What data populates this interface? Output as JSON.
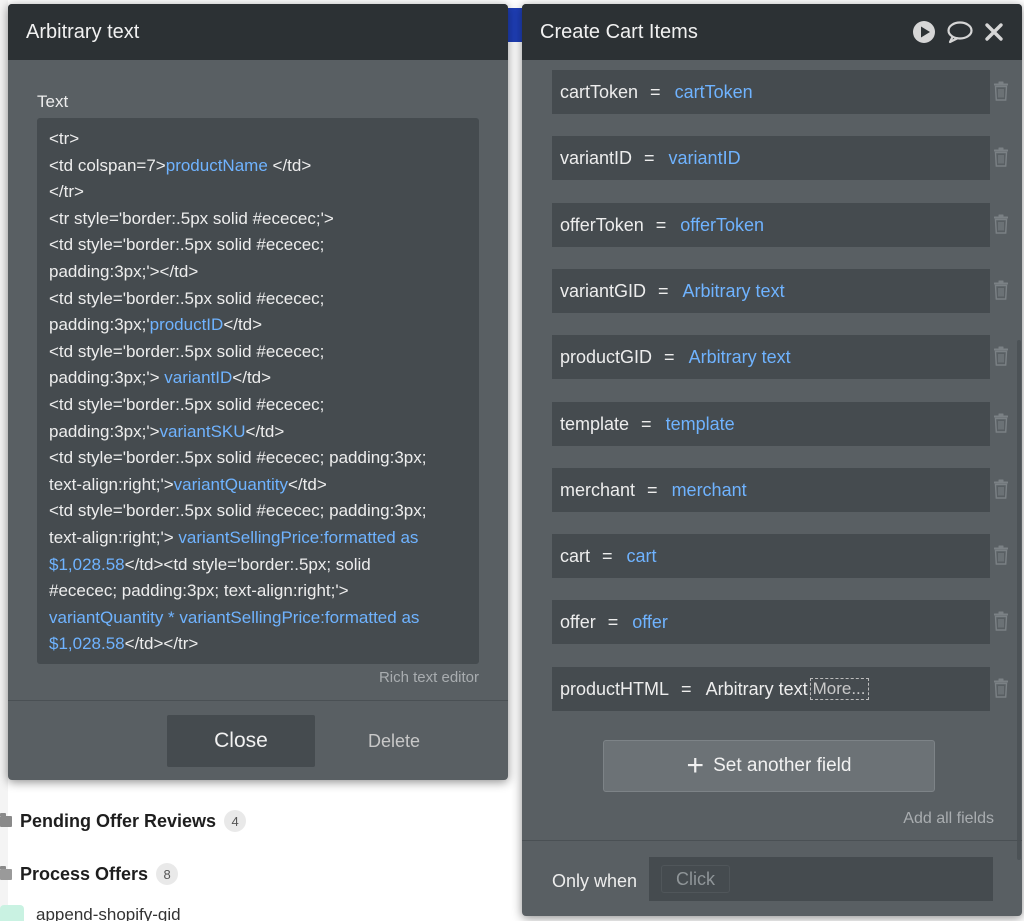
{
  "background": {
    "workflow_items": [
      {
        "label": "Pending Offer Reviews",
        "count": "4"
      },
      {
        "label": "Process Offers",
        "count": "8"
      }
    ],
    "sub_item": "append-shopify-gid"
  },
  "arbitrary_text_panel": {
    "title": "Arbitrary text",
    "field_label": "Text",
    "code_lines": [
      [
        {
          "t": "<tr>"
        }
      ],
      [
        {
          "t": "<td colspan=7>"
        },
        {
          "t": "productName",
          "dyn": true
        },
        {
          "t": " </td>"
        }
      ],
      [
        {
          "t": "</tr>"
        }
      ],
      [
        {
          "t": "<tr style='border:.5px solid #ececec;'>"
        }
      ],
      [
        {
          "t": "<td style='border:.5px solid #ececec;"
        }
      ],
      [
        {
          "t": "padding:3px;'></td>"
        }
      ],
      [
        {
          "t": "<td style='border:.5px solid #ececec;"
        }
      ],
      [
        {
          "t": "padding:3px;'"
        },
        {
          "t": "productID",
          "dyn": true
        },
        {
          "t": "</td>"
        }
      ],
      [
        {
          "t": "<td style='border:.5px solid #ececec;"
        }
      ],
      [
        {
          "t": "padding:3px;'> "
        },
        {
          "t": "variantID",
          "dyn": true
        },
        {
          "t": "</td>"
        }
      ],
      [
        {
          "t": "<td style='border:.5px solid #ececec;"
        }
      ],
      [
        {
          "t": "padding:3px;'>"
        },
        {
          "t": "variantSKU",
          "dyn": true
        },
        {
          "t": "</td>"
        }
      ],
      [
        {
          "t": "<td style='border:.5px solid #ececec; padding:3px;"
        }
      ],
      [
        {
          "t": "text-align:right;'>"
        },
        {
          "t": "variantQuantity",
          "dyn": true
        },
        {
          "t": "</td>"
        }
      ],
      [
        {
          "t": "<td style='border:.5px solid #ececec; padding:3px;"
        }
      ],
      [
        {
          "t": "text-align:right;'> "
        },
        {
          "t": "variantSellingPrice:formatted as",
          "dyn": true
        }
      ],
      [
        {
          "t": "$1,028.58",
          "dyn": true
        },
        {
          "t": "</td><td style='border:.5px; solid"
        }
      ],
      [
        {
          "t": "#ececec; padding:3px; text-align:right;'>"
        }
      ],
      [
        {
          "t": "variantQuantity * variantSellingPrice:formatted as",
          "dyn": true
        }
      ],
      [
        {
          "t": "$1,028.58",
          "dyn": true
        },
        {
          "t": "</td></tr>"
        }
      ]
    ],
    "rich_text_editor_label": "Rich text editor",
    "close_label": "Close",
    "delete_label": "Delete"
  },
  "cart_panel": {
    "title": "Create Cart Items",
    "icons": [
      "play-icon",
      "comment-icon",
      "close-icon"
    ],
    "fields": [
      {
        "key": "cartToken",
        "eq": "=",
        "value": "cartToken",
        "dynamic": true
      },
      {
        "key": "variantID",
        "eq": "=",
        "value": "variantID",
        "dynamic": true
      },
      {
        "key": "offerToken",
        "eq": "=",
        "value": "offerToken",
        "dynamic": true
      },
      {
        "key": "variantGID",
        "eq": "=",
        "value": "Arbitrary text",
        "dynamic": true
      },
      {
        "key": "productGID",
        "eq": "=",
        "value": "Arbitrary text",
        "dynamic": true
      },
      {
        "key": "template",
        "eq": "=",
        "value": "template",
        "dynamic": true
      },
      {
        "key": "merchant",
        "eq": "=",
        "value": "merchant",
        "dynamic": true
      },
      {
        "key": "cart",
        "eq": "=",
        "value": "cart",
        "dynamic": true
      },
      {
        "key": "offer",
        "eq": "=",
        "value": "offer",
        "dynamic": true
      },
      {
        "key": "productHTML",
        "eq": "=",
        "value": "Arbitrary text",
        "dynamic": false,
        "more": "More..."
      }
    ],
    "set_another_field_label": "Set another field",
    "add_all_fields_label": "Add all fields",
    "only_when_label": "Only when",
    "only_when_placeholder": "Click"
  },
  "colors": {
    "panel_bg": "#595f63",
    "header_bg": "#2c3134",
    "field_bg": "#454b4f",
    "dynamic_text": "#6fb3ff",
    "accent_blue": "#1f3fb8"
  }
}
